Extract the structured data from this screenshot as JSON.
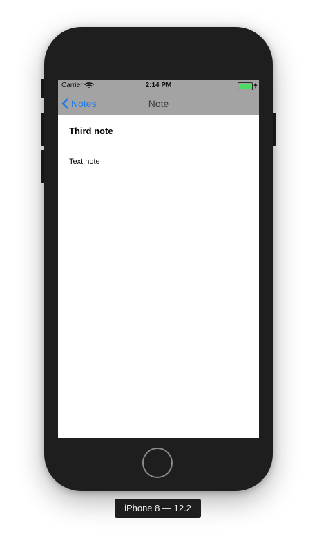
{
  "status_bar": {
    "carrier": "Carrier",
    "time": "2:14 PM",
    "wifi_icon": "wifi-icon",
    "battery_icon": "battery-charging-icon",
    "battery_level": 1.0,
    "battery_color": "#4cd964"
  },
  "nav": {
    "back_label": "Notes",
    "back_icon": "chevron-left-icon",
    "title": "Note",
    "bar_color": "#a3a3a3",
    "accent_color": "#1a7cf0"
  },
  "note": {
    "title": "Third note",
    "body": "Text note"
  },
  "device": {
    "label": "iPhone 8 — 12.2",
    "home_button_icon": "home-button-icon"
  }
}
